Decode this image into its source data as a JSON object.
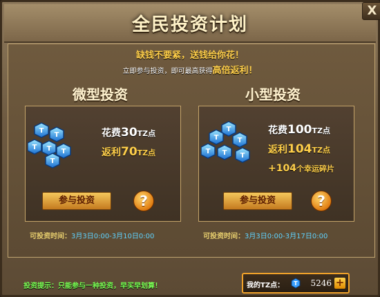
{
  "window": {
    "title": "全民投资计划",
    "close_label": "X"
  },
  "slogan": {
    "line1": "缺钱不要紧，送钱给你花！",
    "line2_prefix": "立即参与投资，即可最高获得",
    "line2_highlight": "高倍返利！"
  },
  "plans": [
    {
      "title": "微型投资",
      "cost_prefix": "花费",
      "cost_value": "30",
      "cost_unit": "TZ点",
      "bonus_prefix": "返利",
      "bonus_value": "70",
      "bonus_unit": "TZ点",
      "extra": "",
      "join_label": "参与投资",
      "help_label": "?",
      "time_label": "可投资时间：",
      "time_value": "3月3日0:00-3月10日0:00"
    },
    {
      "title": "小型投资",
      "cost_prefix": "花费",
      "cost_value": "100",
      "cost_unit": "TZ点",
      "bonus_prefix": "返利",
      "bonus_value": "104",
      "bonus_unit": "TZ点",
      "extra_value": "+104",
      "extra_unit": "个幸运碎片",
      "join_label": "参与投资",
      "help_label": "?",
      "time_label": "可投资时间：",
      "time_value": "3月3日0:00-3月17日0:00"
    }
  ],
  "tip": "投资提示：只能参与一种投资，早买早划算！",
  "wallet": {
    "label": "我的TZ点：",
    "value": "5246",
    "add_label": "+"
  },
  "icons": {
    "gem": "blue-tz-gem-icon",
    "help": "question-mark-icon",
    "close": "close-icon",
    "add": "plus-icon"
  },
  "colors": {
    "gold": "#ffcf4a",
    "cyan": "#5fd3ff",
    "green": "#7cff55",
    "button": "#e0a03a"
  }
}
